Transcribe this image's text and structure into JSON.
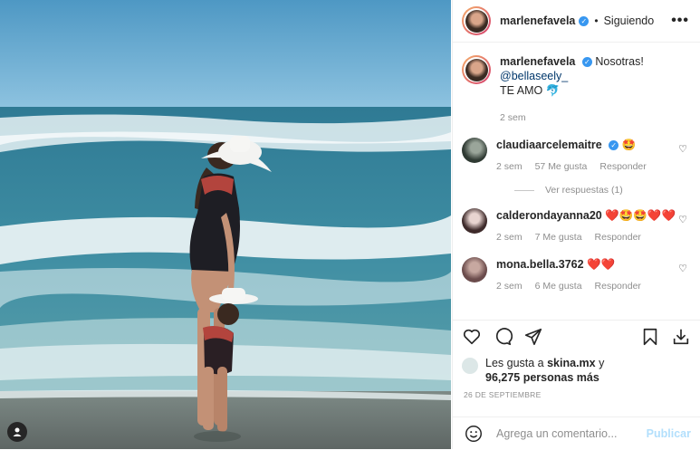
{
  "header": {
    "username": "marlenefavela",
    "separator": "•",
    "follow_status": "Siguiendo",
    "more_label": "•••"
  },
  "caption": {
    "username": "marlenefavela",
    "text": "Nosotras! ",
    "mention": "@bellaseely_",
    "line2": "TE AMO 🐬",
    "time": "2 sem"
  },
  "comments": [
    {
      "username": "claudiaarcelemaitre",
      "text": "🤩",
      "time": "2 sem",
      "likes": "57 Me gusta",
      "reply": "Responder",
      "avatar_color": "#3b4a3e"
    },
    {
      "username": "calderondayanna20",
      "text": "❤️🤩🤩❤️❤️",
      "time": "2 sem",
      "likes": "7 Me gusta",
      "reply": "Responder",
      "avatar_color": "#5a3a3a"
    },
    {
      "username": "mona.bella.3762",
      "text": "❤️❤️",
      "time": "2 sem",
      "likes": "6 Me gusta",
      "reply": "Responder",
      "avatar_color": "#8a6a6a"
    }
  ],
  "view_replies": "Ver respuestas (1)",
  "likes": {
    "prefix": "Les gusta a ",
    "user": "skina.mx",
    "suffix": " y",
    "line2": "96,275 personas más"
  },
  "date": "26 DE SEPTIEMBRE",
  "add_comment": {
    "placeholder": "Agrega un comentario...",
    "publish": "Publicar"
  },
  "icons": [
    "heart-icon",
    "comment-icon",
    "share-icon",
    "bookmark-icon",
    "download-icon",
    "emoji-icon",
    "user-icon"
  ],
  "colors": {
    "verified": "#3897f0",
    "link": "#00376b",
    "muted": "#8e8e8e",
    "publish": "#b2dffc"
  }
}
